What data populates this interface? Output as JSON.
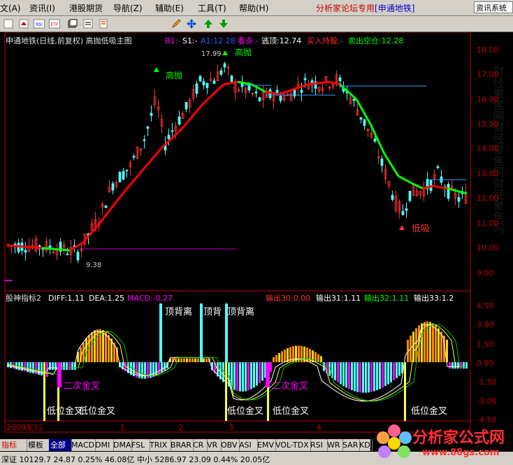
{
  "menu": {
    "items": [
      {
        "label": "文(A)"
      },
      {
        "label": "资讯(I)"
      },
      {
        "label": "港股期货"
      },
      {
        "label": "导航(Z)"
      },
      {
        "label": "辅助(E)"
      },
      {
        "label": "工具(T)"
      },
      {
        "label": "帮助(H)"
      }
    ],
    "brand": "分析家论坛专用",
    "stock_tag": "[申通地铁]",
    "right_button": "资讯系统"
  },
  "toolbar": {
    "icons": [
      "blank-icon",
      "home-icon",
      "rsi-icon",
      "etf-icon",
      "stack-icon",
      "edit-icon",
      "scroll-icon",
      "pencil-icon",
      "move-icon",
      "arrow-up-icon",
      "arrow-down-icon"
    ],
    "icon_labels": {
      "rsi": "RSI",
      "etf": "ETF"
    }
  },
  "main_chart": {
    "title_left": "申通地铁(日线,前复权) 高抛低吸主图",
    "b1": "B1:-",
    "s1": "S1:-",
    "a1": "A1:12.28",
    "kanduo": "看多:-",
    "taoding": "逃顶:12.74",
    "mairu": "买入持股:-",
    "maichu": "卖出空仓:12.28",
    "y_ticks": [
      "18.00",
      "17.00",
      "16.00",
      "15.00",
      "14.00",
      "13.00",
      "12.00",
      "11.00",
      "10.00",
      "9.00"
    ],
    "annotations": {
      "high_price": "17.99",
      "low_price": "9.38",
      "gaopao_1": "高抛",
      "gaopao_2": "高抛",
      "dixi": "低吸"
    },
    "side_watermark": "财经聚焦网财经聚焦网财经聚焦网"
  },
  "sub_chart": {
    "title": "股神指标2",
    "diff": "DIFF:1.11",
    "dea": "DEA:1.25",
    "macd": "MACD:-0.27",
    "out30": "输出30:0.00",
    "out31": "输出31:1.11",
    "out32": "输出32:1.11",
    "out33": "输出33:1.2",
    "y_ticks": [
      "4.50",
      "3.00",
      "1.50",
      "0.00",
      "-1.50",
      "-3.00",
      "-4.50"
    ],
    "labels": {
      "dingbeili_1": "顶背离",
      "dingbeili_2": "顶背",
      "dingbeili_3": "顶背离",
      "erci_1": "二次金叉",
      "erci_2": "二次金叉",
      "diwei_1": "低位",
      "diwei_2": "金叉",
      "diwei_3": "低位金叉",
      "diwei_4": "低位金叉",
      "diwei_5": "低位金叉",
      "diwei_6": "低位金叉"
    }
  },
  "x_axis": {
    "labels": [
      "2009年12",
      "1",
      "2",
      "3",
      "4"
    ]
  },
  "tabs": [
    "指标",
    "模板",
    "全部",
    "MACD",
    "DMI",
    "DMA",
    "FSL",
    "TRIX",
    "BRAR",
    "CR",
    "VR",
    "OBV",
    "ASI",
    "EMV",
    "VOL-TDX",
    "RSI",
    "WR",
    "SAR",
    "KDJ"
  ],
  "watermark": {
    "title": "分析家公式网",
    "url": "www.88gs.com"
  },
  "status": {
    "text": "深证 10129.7  24.87  0.25%  46.08亿 中小 5286.97  23.09  0.44%  20.05亿"
  },
  "colors": {
    "up": "#ff3232",
    "down": "#54fcfc",
    "ma_red": "#ff0000",
    "ma_green": "#00ff00",
    "axis": "#c00000",
    "macd_pos_orange": "#ff8c00",
    "macd_pos_yellow": "#ffd700",
    "macd_neg_cyan": "#54fcfc",
    "macd_neg_magenta": "#ff00ff"
  }
}
